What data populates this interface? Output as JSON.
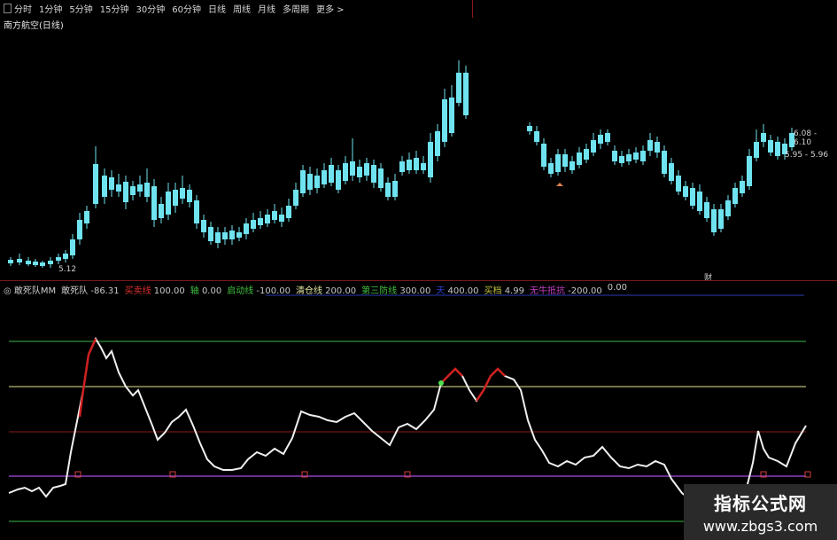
{
  "toolbar": {
    "items": [
      "分时",
      "1分钟",
      "5分钟",
      "15分钟",
      "30分钟",
      "60分钟",
      "日线",
      "周线",
      "月线",
      "多周期",
      "更多 >"
    ]
  },
  "stock_title": "南方航空(日线)",
  "price_labels": {
    "low": "5.12",
    "bid": "6.08 - 6.10",
    "ask": "5.95 - 5.96",
    "fin_marker": "财"
  },
  "indicator": {
    "name": "敢死队MM",
    "items": [
      {
        "label": "敢死队",
        "value": "-86.31",
        "color": "#d0d0d0"
      },
      {
        "label": "买卖线",
        "value": "100.00",
        "color": "#e03030"
      },
      {
        "label": "轴",
        "value": "0.00",
        "color": "#40c040"
      },
      {
        "label": "启动线",
        "value": "-100.00",
        "color": "#40c040"
      },
      {
        "label": "清仓线",
        "value": "200.00",
        "color": "#e0e0a0"
      },
      {
        "label": "第三防线",
        "value": "300.00",
        "color": "#40c040"
      },
      {
        "label": "天",
        "value": "400.00",
        "color": "#3040d0"
      },
      {
        "label": "买档",
        "value": "4.99",
        "color": "#c0c040"
      },
      {
        "label": "无牛抵抗",
        "value": "-200.00",
        "color": "#c040c0"
      },
      {
        "label": "",
        "value": "0.00",
        "color": "#c8c8c8"
      }
    ]
  },
  "colors": {
    "up": "#c0392b",
    "down": "#6fe3f0",
    "line_green": "#3cb84a",
    "line_yellow": "#e6e690",
    "line_red": "#8b1a1a",
    "line_purple": "#8a3fbf",
    "line_blue": "#2a3ab0"
  },
  "watermark": {
    "cn": "指标公式网",
    "url": "www.zbgs3.com"
  }
}
